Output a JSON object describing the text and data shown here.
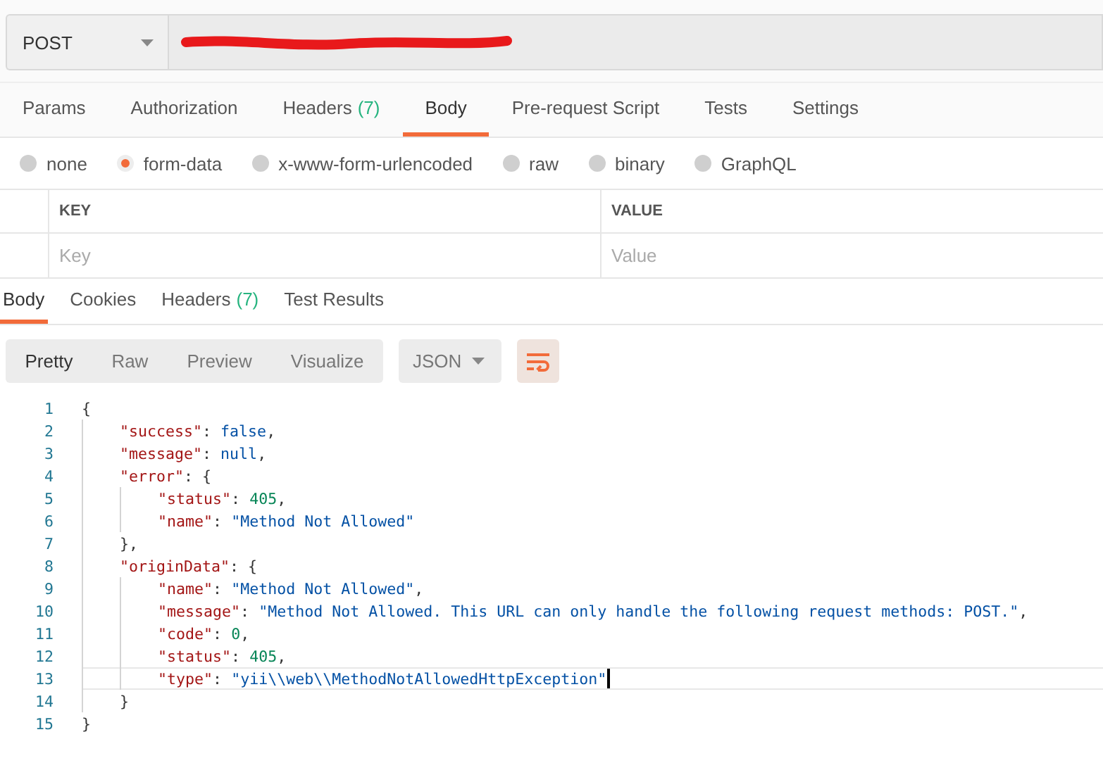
{
  "request": {
    "method": "POST"
  },
  "request_tabs": [
    {
      "label": "Params",
      "selected": false
    },
    {
      "label": "Authorization",
      "selected": false
    },
    {
      "label": "Headers",
      "count": "(7)",
      "selected": false
    },
    {
      "label": "Body",
      "selected": true
    },
    {
      "label": "Pre-request Script",
      "selected": false
    },
    {
      "label": "Tests",
      "selected": false
    },
    {
      "label": "Settings",
      "selected": false
    }
  ],
  "body_types": [
    {
      "label": "none",
      "selected": false
    },
    {
      "label": "form-data",
      "selected": true
    },
    {
      "label": "x-www-form-urlencoded",
      "selected": false
    },
    {
      "label": "raw",
      "selected": false
    },
    {
      "label": "binary",
      "selected": false
    },
    {
      "label": "GraphQL",
      "selected": false
    }
  ],
  "params_table": {
    "columns": [
      "KEY",
      "VALUE"
    ],
    "row": {
      "key_placeholder": "Key",
      "value_placeholder": "Value"
    }
  },
  "response_tabs": [
    {
      "label": "Body",
      "selected": true
    },
    {
      "label": "Cookies",
      "selected": false
    },
    {
      "label": "Headers",
      "count": "(7)",
      "selected": false
    },
    {
      "label": "Test Results",
      "selected": false
    }
  ],
  "view_modes": [
    {
      "label": "Pretty",
      "selected": true
    },
    {
      "label": "Raw",
      "selected": false
    },
    {
      "label": "Preview",
      "selected": false
    },
    {
      "label": "Visualize",
      "selected": false
    }
  ],
  "format": {
    "value": "JSON"
  },
  "code_lines": [
    {
      "number": "1",
      "current": false,
      "tokens": [
        {
          "kind": "punct",
          "text": "{"
        }
      ],
      "children": [
        {
          "number": "2",
          "current": false,
          "tokens": [
            {
              "kind": "key",
              "text": "\"success\""
            },
            {
              "kind": "punct",
              "text": ": "
            },
            {
              "kind": "keyword",
              "text": "false"
            },
            {
              "kind": "punct",
              "text": ","
            }
          ]
        },
        {
          "number": "3",
          "current": false,
          "tokens": [
            {
              "kind": "key",
              "text": "\"message\""
            },
            {
              "kind": "punct",
              "text": ": "
            },
            {
              "kind": "keyword",
              "text": "null"
            },
            {
              "kind": "punct",
              "text": ","
            }
          ]
        },
        {
          "number": "4",
          "current": false,
          "tokens": [
            {
              "kind": "key",
              "text": "\"error\""
            },
            {
              "kind": "punct",
              "text": ": {"
            }
          ],
          "children": [
            {
              "number": "5",
              "current": false,
              "tokens": [
                {
                  "kind": "key",
                  "text": "\"status\""
                },
                {
                  "kind": "punct",
                  "text": ": "
                },
                {
                  "kind": "number",
                  "text": "405"
                },
                {
                  "kind": "punct",
                  "text": ","
                }
              ]
            },
            {
              "number": "6",
              "current": false,
              "tokens": [
                {
                  "kind": "key",
                  "text": "\"name\""
                },
                {
                  "kind": "punct",
                  "text": ": "
                },
                {
                  "kind": "string",
                  "text": "\"Method Not Allowed\""
                }
              ]
            }
          ]
        },
        {
          "number": "7",
          "current": false,
          "tokens": [
            {
              "kind": "punct",
              "text": "},"
            }
          ]
        },
        {
          "number": "8",
          "current": false,
          "tokens": [
            {
              "kind": "key",
              "text": "\"originData\""
            },
            {
              "kind": "punct",
              "text": ": {"
            }
          ],
          "children": [
            {
              "number": "9",
              "current": false,
              "tokens": [
                {
                  "kind": "key",
                  "text": "\"name\""
                },
                {
                  "kind": "punct",
                  "text": ": "
                },
                {
                  "kind": "string",
                  "text": "\"Method Not Allowed\""
                },
                {
                  "kind": "punct",
                  "text": ","
                }
              ]
            },
            {
              "number": "10",
              "current": false,
              "tokens": [
                {
                  "kind": "key",
                  "text": "\"message\""
                },
                {
                  "kind": "punct",
                  "text": ": "
                },
                {
                  "kind": "string",
                  "text": "\"Method Not Allowed. This URL can only handle the following request methods: POST.\""
                },
                {
                  "kind": "punct",
                  "text": ","
                }
              ]
            },
            {
              "number": "11",
              "current": false,
              "tokens": [
                {
                  "kind": "key",
                  "text": "\"code\""
                },
                {
                  "kind": "punct",
                  "text": ": "
                },
                {
                  "kind": "number",
                  "text": "0"
                },
                {
                  "kind": "punct",
                  "text": ","
                }
              ]
            },
            {
              "number": "12",
              "current": false,
              "tokens": [
                {
                  "kind": "key",
                  "text": "\"status\""
                },
                {
                  "kind": "punct",
                  "text": ": "
                },
                {
                  "kind": "number",
                  "text": "405"
                },
                {
                  "kind": "punct",
                  "text": ","
                }
              ]
            },
            {
              "number": "13",
              "current": true,
              "tokens": [
                {
                  "kind": "key",
                  "text": "\"type\""
                },
                {
                  "kind": "punct",
                  "text": ": "
                },
                {
                  "kind": "string",
                  "text": "\"yii\\\\web\\\\MethodNotAllowedHttpException\""
                }
              ]
            }
          ]
        },
        {
          "number": "14",
          "current": false,
          "tokens": [
            {
              "kind": "punct",
              "text": "}"
            }
          ]
        }
      ]
    },
    {
      "number": "15",
      "current": false,
      "tokens": [
        {
          "kind": "punct",
          "text": "}"
        }
      ]
    }
  ]
}
